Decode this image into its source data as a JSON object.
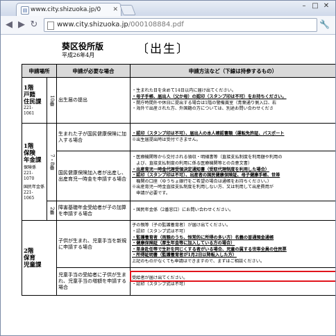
{
  "browser": {
    "tab_title": "www.city.shizuoka.jp/0",
    "favicon": "page-icon",
    "url_host": "www.city.shizuoka.jp",
    "url_path": "/000108884.pdf"
  },
  "document": {
    "ward": "葵区役所版",
    "date": "平成26年4月",
    "title": "〔出生〕",
    "headers": [
      "申請場所",
      "申請が必要な場合",
      "申請方法など（下線は持参するもの）"
    ],
    "rows": {
      "r1": {
        "place": "1階\n戸籍\n住民課",
        "phone": "221-\n1061",
        "num": "10番",
        "cond": "出生届の提出",
        "lines": [
          "・生まれた日を含めて14日以内に届け出てください。",
          "・母子手帳、届出人（父か母）の認印（スタンプ印は不可）をお持ちください。",
          "・開庁時間外や休日に提出する場合は1階の警備員室（青葉通り側入口、右",
          "・海外で出産された方、外国籍の方については、別途お問い合わせくださ"
        ]
      },
      "r2": {
        "place": "1階\n保険\n年金課",
        "phone1": "保険係\n221-\n1070",
        "phone2": "国民年金係\n221-\n1065",
        "num": "7・8番",
        "cond": "生まれた子が国民健康保険に加入する場合",
        "lines": [
          "・認印（スタンプ印は不可）、届出人の本人確認書類（運転免許証、パスポート",
          "※出生届提出時は受付できません。"
        ]
      },
      "r3": {
        "cond": "国民健康保険加入者が出産し、出産育児一時金を申請する場合",
        "lines": [
          "・医療機関等から交付される領収・明細書等（直接支払制度を利用額や利用の",
          "　よび、直接支払制度の利用に係る医療機関等との合意文書）",
          "・出産育児一時金代理受領決定通知書（受取代理制度を利用した場合）",
          "・認印（スタンプ印は不可）、出産者の国民健康保険証、母子健康手帳、世帯",
          "　機関の口座（ゆうちょ銀行をご希望の場合は通帳をお持ちください。）",
          "※出産育児一時金直接支払制度を利用しない方、又は利用して出産費用が",
          "　申請が必要です。"
        ]
      },
      "r4": {
        "num": "2番",
        "cond": "障害基礎年金受給者が子の加算を申請する場合",
        "lines": [
          "・国民年金係（2番窓口）にお問い合わせください。"
        ]
      },
      "r5": {
        "place": "2階\n保育\n児童課",
        "cond": "子供が生まれ、児童手当を新規に申請する場合",
        "lines": [
          "子の親等（子の監護養育者）が届け出てください。",
          "・認印（スタンプ式は不可）",
          "・監護養育者（両親のうち、恒常的に所得の多い方）名義の普通預金通帳",
          "・健康保険証（厚生年金等に加入している方の場合）",
          "・単身赴任等で生計を同じくする者がいる場合、児童の属する世帯全員の住民票",
          "・所得証明書（監護養育者が1月2日以降転入した方）",
          "上記のものがなくても申請はできますので、まずはご相談ください。"
        ]
      },
      "r6": {
        "cond": "児童手当の受給者に子供が生まれ、児童手当の増額を申請する場合",
        "lines": [
          "受給者が届け出てください。",
          "・認印（スタンプ式は不可）"
        ]
      }
    }
  }
}
